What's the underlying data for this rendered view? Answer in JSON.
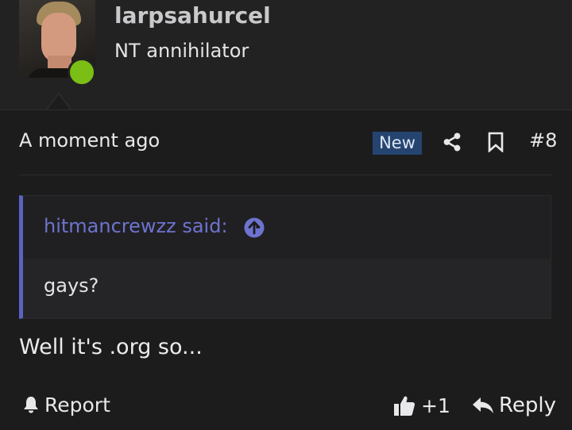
{
  "user": {
    "username": "larpsahurcel",
    "title": "NT annihilator",
    "online_color": "#7bbf16"
  },
  "post": {
    "timestamp": "A moment ago",
    "badge": "New",
    "number": "#8",
    "icons": [
      "share-icon",
      "bookmark-icon"
    ],
    "quote": {
      "author": "hitmancrewzz said:",
      "text": "gays?",
      "accent_color": "#5b62c4"
    },
    "body": "Well it's .org so..."
  },
  "actions": {
    "report_label": "Report",
    "like_count": "+1",
    "reply_label": "Reply"
  },
  "colors": {
    "background": "#1c1c1d",
    "badge_bg": "#254470",
    "quote_link": "#6d73cf"
  }
}
